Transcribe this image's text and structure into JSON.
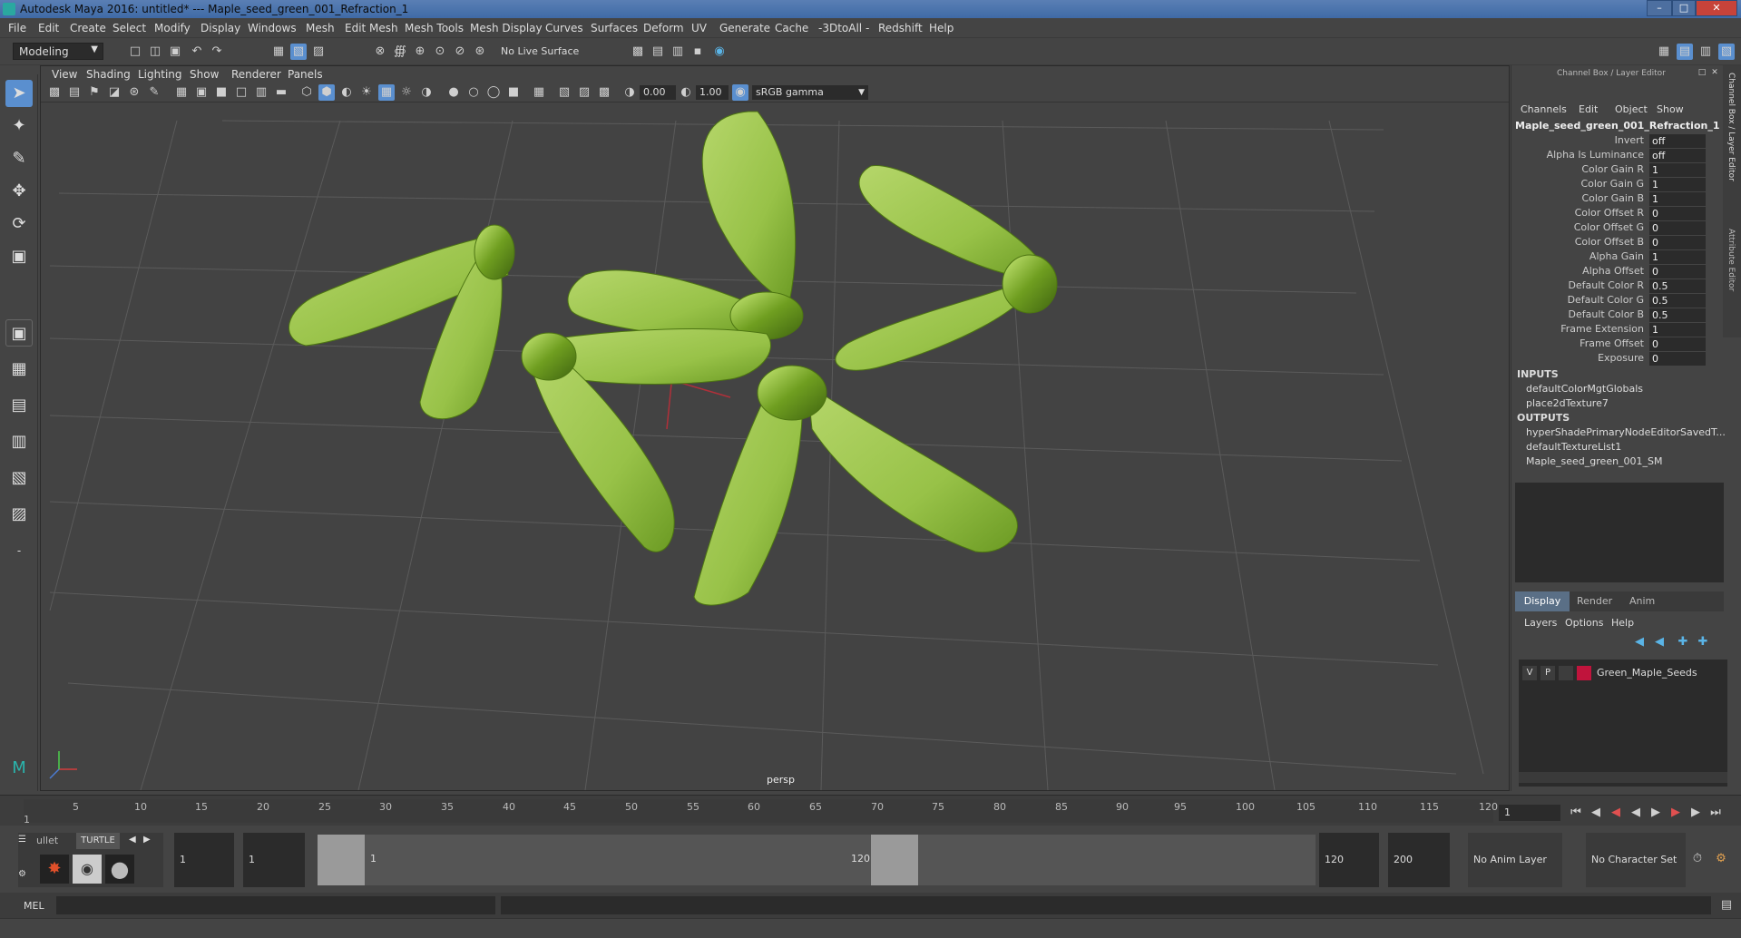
{
  "window": {
    "title": "Autodesk Maya 2016: untitled*   ---   Maple_seed_green_001_Refraction_1"
  },
  "menubar": [
    "File",
    "Edit",
    "Create",
    "Select",
    "Modify",
    "Display",
    "Windows",
    "Mesh",
    "Edit Mesh",
    "Mesh Tools",
    "Mesh Display",
    "Curves",
    "Surfaces",
    "Deform",
    "UV",
    "Generate",
    "Cache",
    "-3DtoAll -",
    "Redshift",
    "Help"
  ],
  "shelf": {
    "mode": "Modeling",
    "live_surface": "No Live Surface"
  },
  "panel": {
    "menus": [
      "View",
      "Shading",
      "Lighting",
      "Show",
      "Renderer",
      "Panels"
    ],
    "field_a": "0.00",
    "field_b": "1.00",
    "color_space": "sRGB gamma",
    "camera_label": "persp"
  },
  "channelbox": {
    "header": "Channel Box / Layer Editor",
    "menus": [
      "Channels",
      "Edit",
      "Object",
      "Show"
    ],
    "node": "Maple_seed_green_001_Refraction_1",
    "attributes": [
      {
        "label": "Invert",
        "value": "off"
      },
      {
        "label": "Alpha Is Luminance",
        "value": "off"
      },
      {
        "label": "Color Gain R",
        "value": "1"
      },
      {
        "label": "Color Gain G",
        "value": "1"
      },
      {
        "label": "Color Gain B",
        "value": "1"
      },
      {
        "label": "Color Offset R",
        "value": "0"
      },
      {
        "label": "Color Offset G",
        "value": "0"
      },
      {
        "label": "Color Offset B",
        "value": "0"
      },
      {
        "label": "Alpha Gain",
        "value": "1"
      },
      {
        "label": "Alpha Offset",
        "value": "0"
      },
      {
        "label": "Default Color R",
        "value": "0.5"
      },
      {
        "label": "Default Color G",
        "value": "0.5"
      },
      {
        "label": "Default Color B",
        "value": "0.5"
      },
      {
        "label": "Frame Extension",
        "value": "1"
      },
      {
        "label": "Frame Offset",
        "value": "0"
      },
      {
        "label": "Exposure",
        "value": "0"
      }
    ],
    "inputs_title": "INPUTS",
    "inputs": [
      "defaultColorMgtGlobals",
      "place2dTexture7"
    ],
    "outputs_title": "OUTPUTS",
    "outputs": [
      "hyperShadePrimaryNodeEditorSavedT...",
      "defaultTextureList1",
      "Maple_seed_green_001_SM"
    ],
    "side_tabs": [
      "Channel Box / Layer Editor",
      "Attribute Editor"
    ]
  },
  "layer_editor": {
    "tabs": [
      "Display",
      "Render",
      "Anim"
    ],
    "menus": [
      "Layers",
      "Options",
      "Help"
    ],
    "layer": {
      "v": "V",
      "p": "P",
      "name": "Green_Maple_Seeds",
      "color": "#c0143c"
    }
  },
  "timeline": {
    "ticks": [
      "1",
      "5",
      "10",
      "15",
      "20",
      "25",
      "30",
      "35",
      "40",
      "45",
      "50",
      "55",
      "60",
      "65",
      "70",
      "75",
      "80",
      "85",
      "90",
      "95",
      "100",
      "105",
      "110",
      "115",
      "120"
    ],
    "current_frame": "1"
  },
  "range": {
    "shelf_tabs": [
      "ullet",
      "TURTLE"
    ],
    "start": "1",
    "inner_start": "1",
    "slider_start": "1",
    "slider_end": "120",
    "end": "120",
    "max": "200",
    "anim_layer": "No Anim Layer",
    "char_set": "No Character Set"
  },
  "command": {
    "label": "MEL"
  }
}
